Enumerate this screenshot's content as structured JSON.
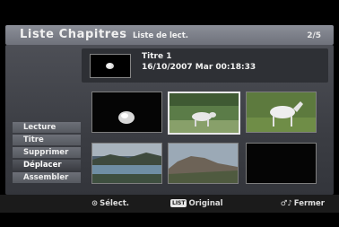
{
  "header": {
    "title": "Liste Chapitres",
    "subtitle": "Liste de lect.",
    "page_indicator": "2/5"
  },
  "selected_info": {
    "title": "Titre 1",
    "datetime": "16/10/2007  Mar  00:18:33"
  },
  "menu": {
    "items": [
      {
        "label": "Lecture"
      },
      {
        "label": "Titre"
      },
      {
        "label": "Supprimer"
      },
      {
        "label": "Déplacer",
        "active": true
      },
      {
        "label": "Assembler"
      }
    ]
  },
  "footer": {
    "select_icon": "⊙",
    "select_label": "Sélect.",
    "list_badge": "LIST",
    "original_label": "Original",
    "close_icon": "♂♪",
    "close_label": "Fermer"
  },
  "thumbnails": [
    {
      "name": "ball-on-dark-thumb"
    },
    {
      "name": "horse-in-field-thumb",
      "selected": true
    },
    {
      "name": "white-horse-thumb"
    },
    {
      "name": "river-landscape-thumb"
    },
    {
      "name": "mountain-rocks-thumb"
    },
    {
      "name": "empty-thumb"
    }
  ]
}
